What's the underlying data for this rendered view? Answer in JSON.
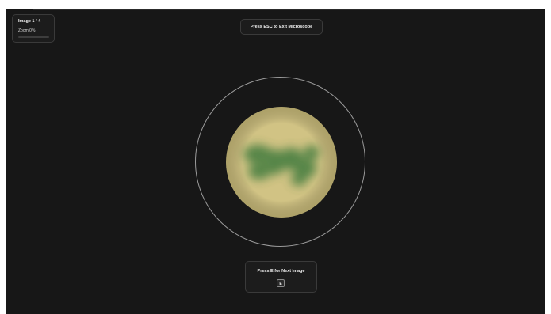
{
  "status": {
    "image_counter": "Image 1 / 4",
    "zoom_text": "Zoom 0%",
    "zoom_fraction": 0
  },
  "hints": {
    "exit": "Press ESC to  Exit Microscope",
    "next": "Press E for Next Image",
    "next_key": "E"
  },
  "colors": {
    "background": "#171717",
    "specimen": "#d1c384",
    "blob": "#3f7a3e",
    "ring": "#9a9a9a"
  }
}
